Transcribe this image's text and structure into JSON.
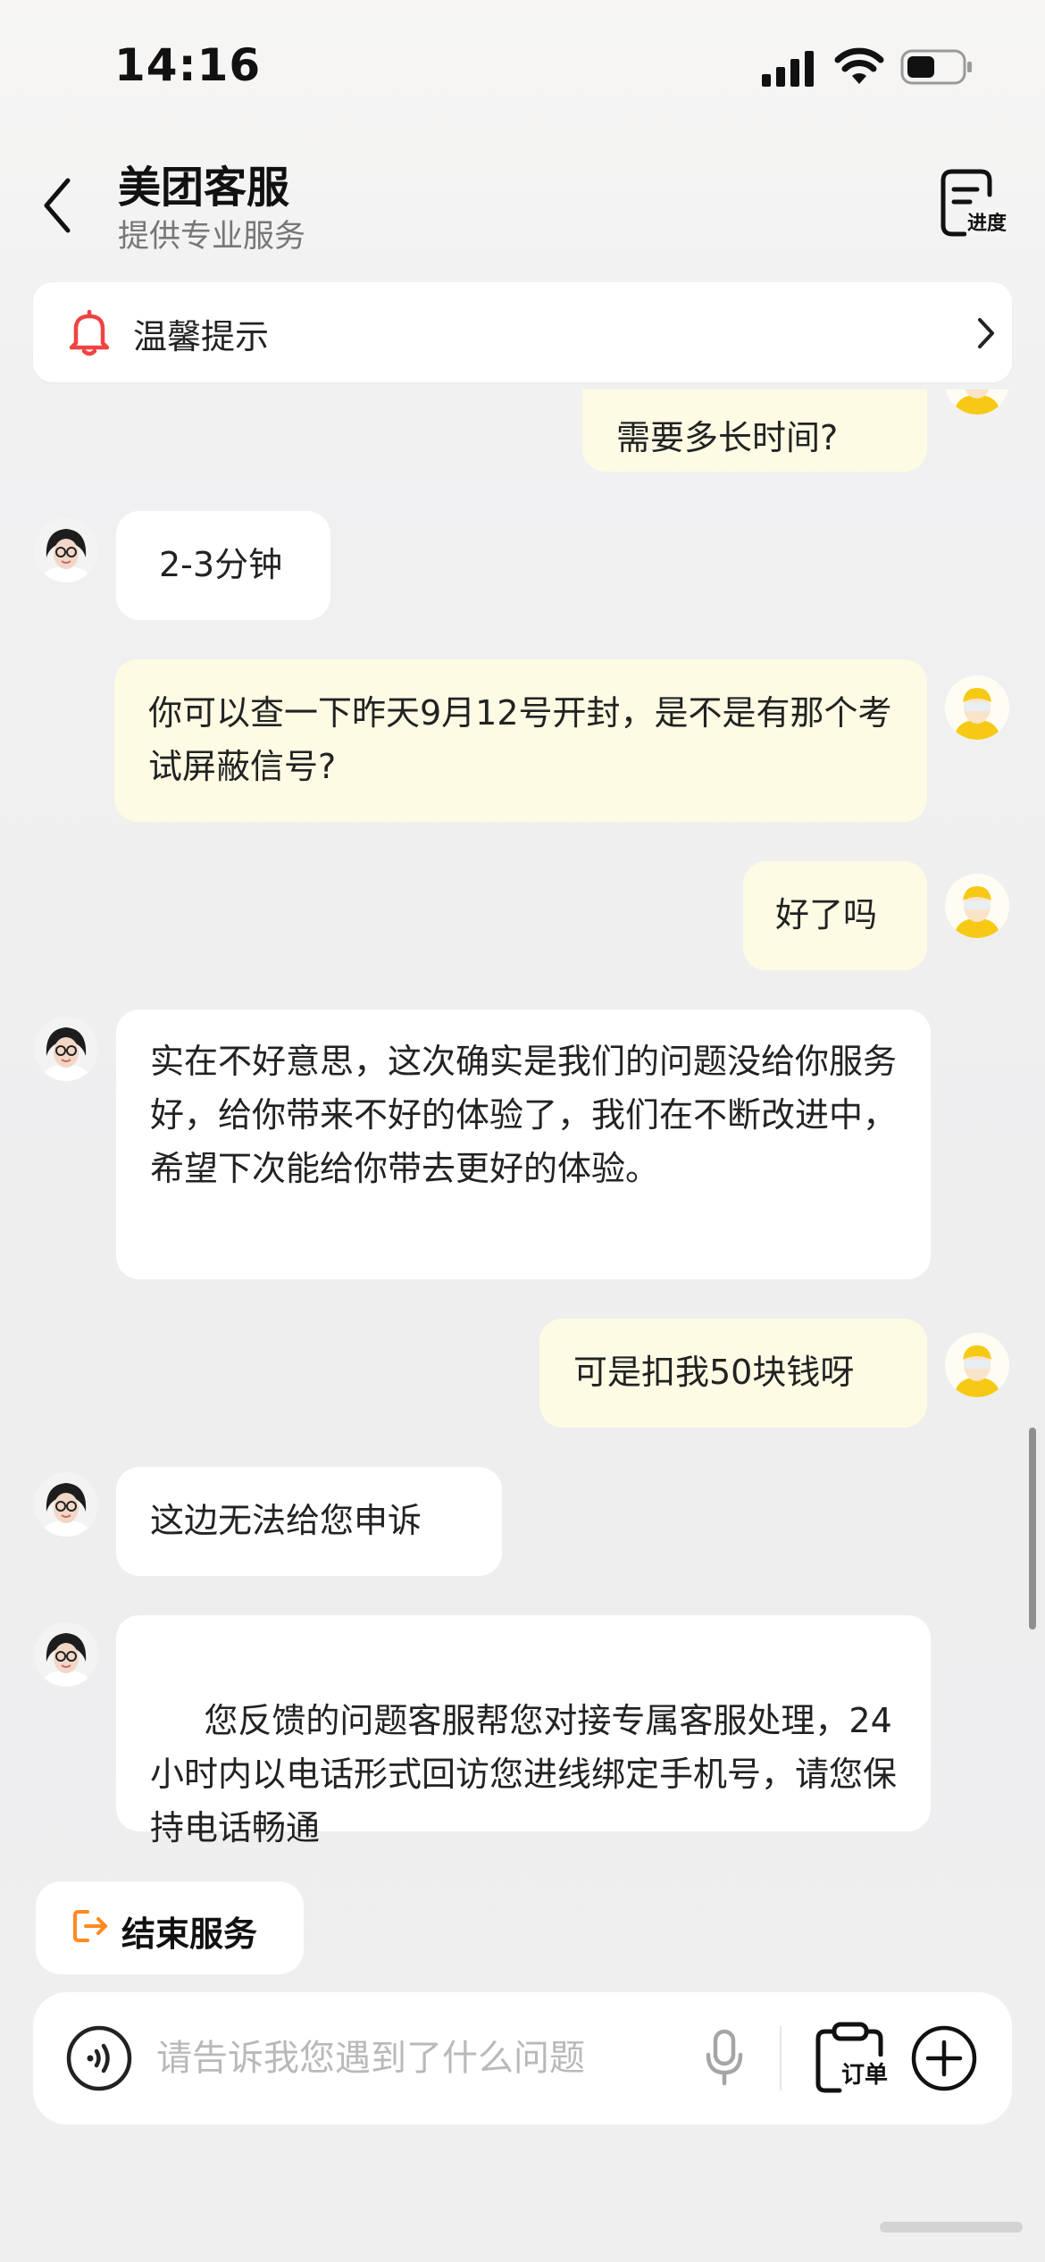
{
  "status_bar": {
    "time": "14:16"
  },
  "header": {
    "title": "美团客服",
    "subtitle": "提供专业服务",
    "progress_label": "进度"
  },
  "notice": {
    "text": "温馨提示"
  },
  "messages": [
    {
      "sender": "user",
      "text": "需要多长时间?"
    },
    {
      "sender": "agent",
      "text": "2-3分钟"
    },
    {
      "sender": "user",
      "text": "你可以查一下昨天9月12号开封，是不是有那个考试屏蔽信号?"
    },
    {
      "sender": "user",
      "text": "好了吗"
    },
    {
      "sender": "agent",
      "text": "实在不好意思，这次确实是我们的问题没给你服务好，给你带来不好的体验了，我们在不断改进中，希望下次能给你带去更好的体验。"
    },
    {
      "sender": "user",
      "text": "可是扣我50块钱呀"
    },
    {
      "sender": "agent",
      "text": "这边无法给您申诉"
    },
    {
      "sender": "agent",
      "text": " 您反馈的问题客服帮您对接专属客服处理，24小时内以电话形式回访您进线绑定手机号，请您保持电话畅通"
    }
  ],
  "end_service": {
    "label": "结束服务"
  },
  "input": {
    "placeholder": "请告诉我您遇到了什么问题",
    "value": ""
  },
  "order_button": {
    "label": "订单"
  },
  "colors": {
    "accent_orange": "#ff8a1f",
    "bell_red": "#f04343",
    "user_bubble": "#fdfbe4",
    "agent_bubble": "#ffffff"
  },
  "icons": {
    "back": "chevron-left-icon",
    "progress": "document-progress-icon",
    "notice": "bell-icon",
    "notice_more": "chevron-right-icon",
    "end_service": "exit-icon",
    "voice": "voice-toggle-icon",
    "mic": "microphone-icon",
    "order": "clipboard-icon",
    "more": "plus-circle-icon"
  }
}
